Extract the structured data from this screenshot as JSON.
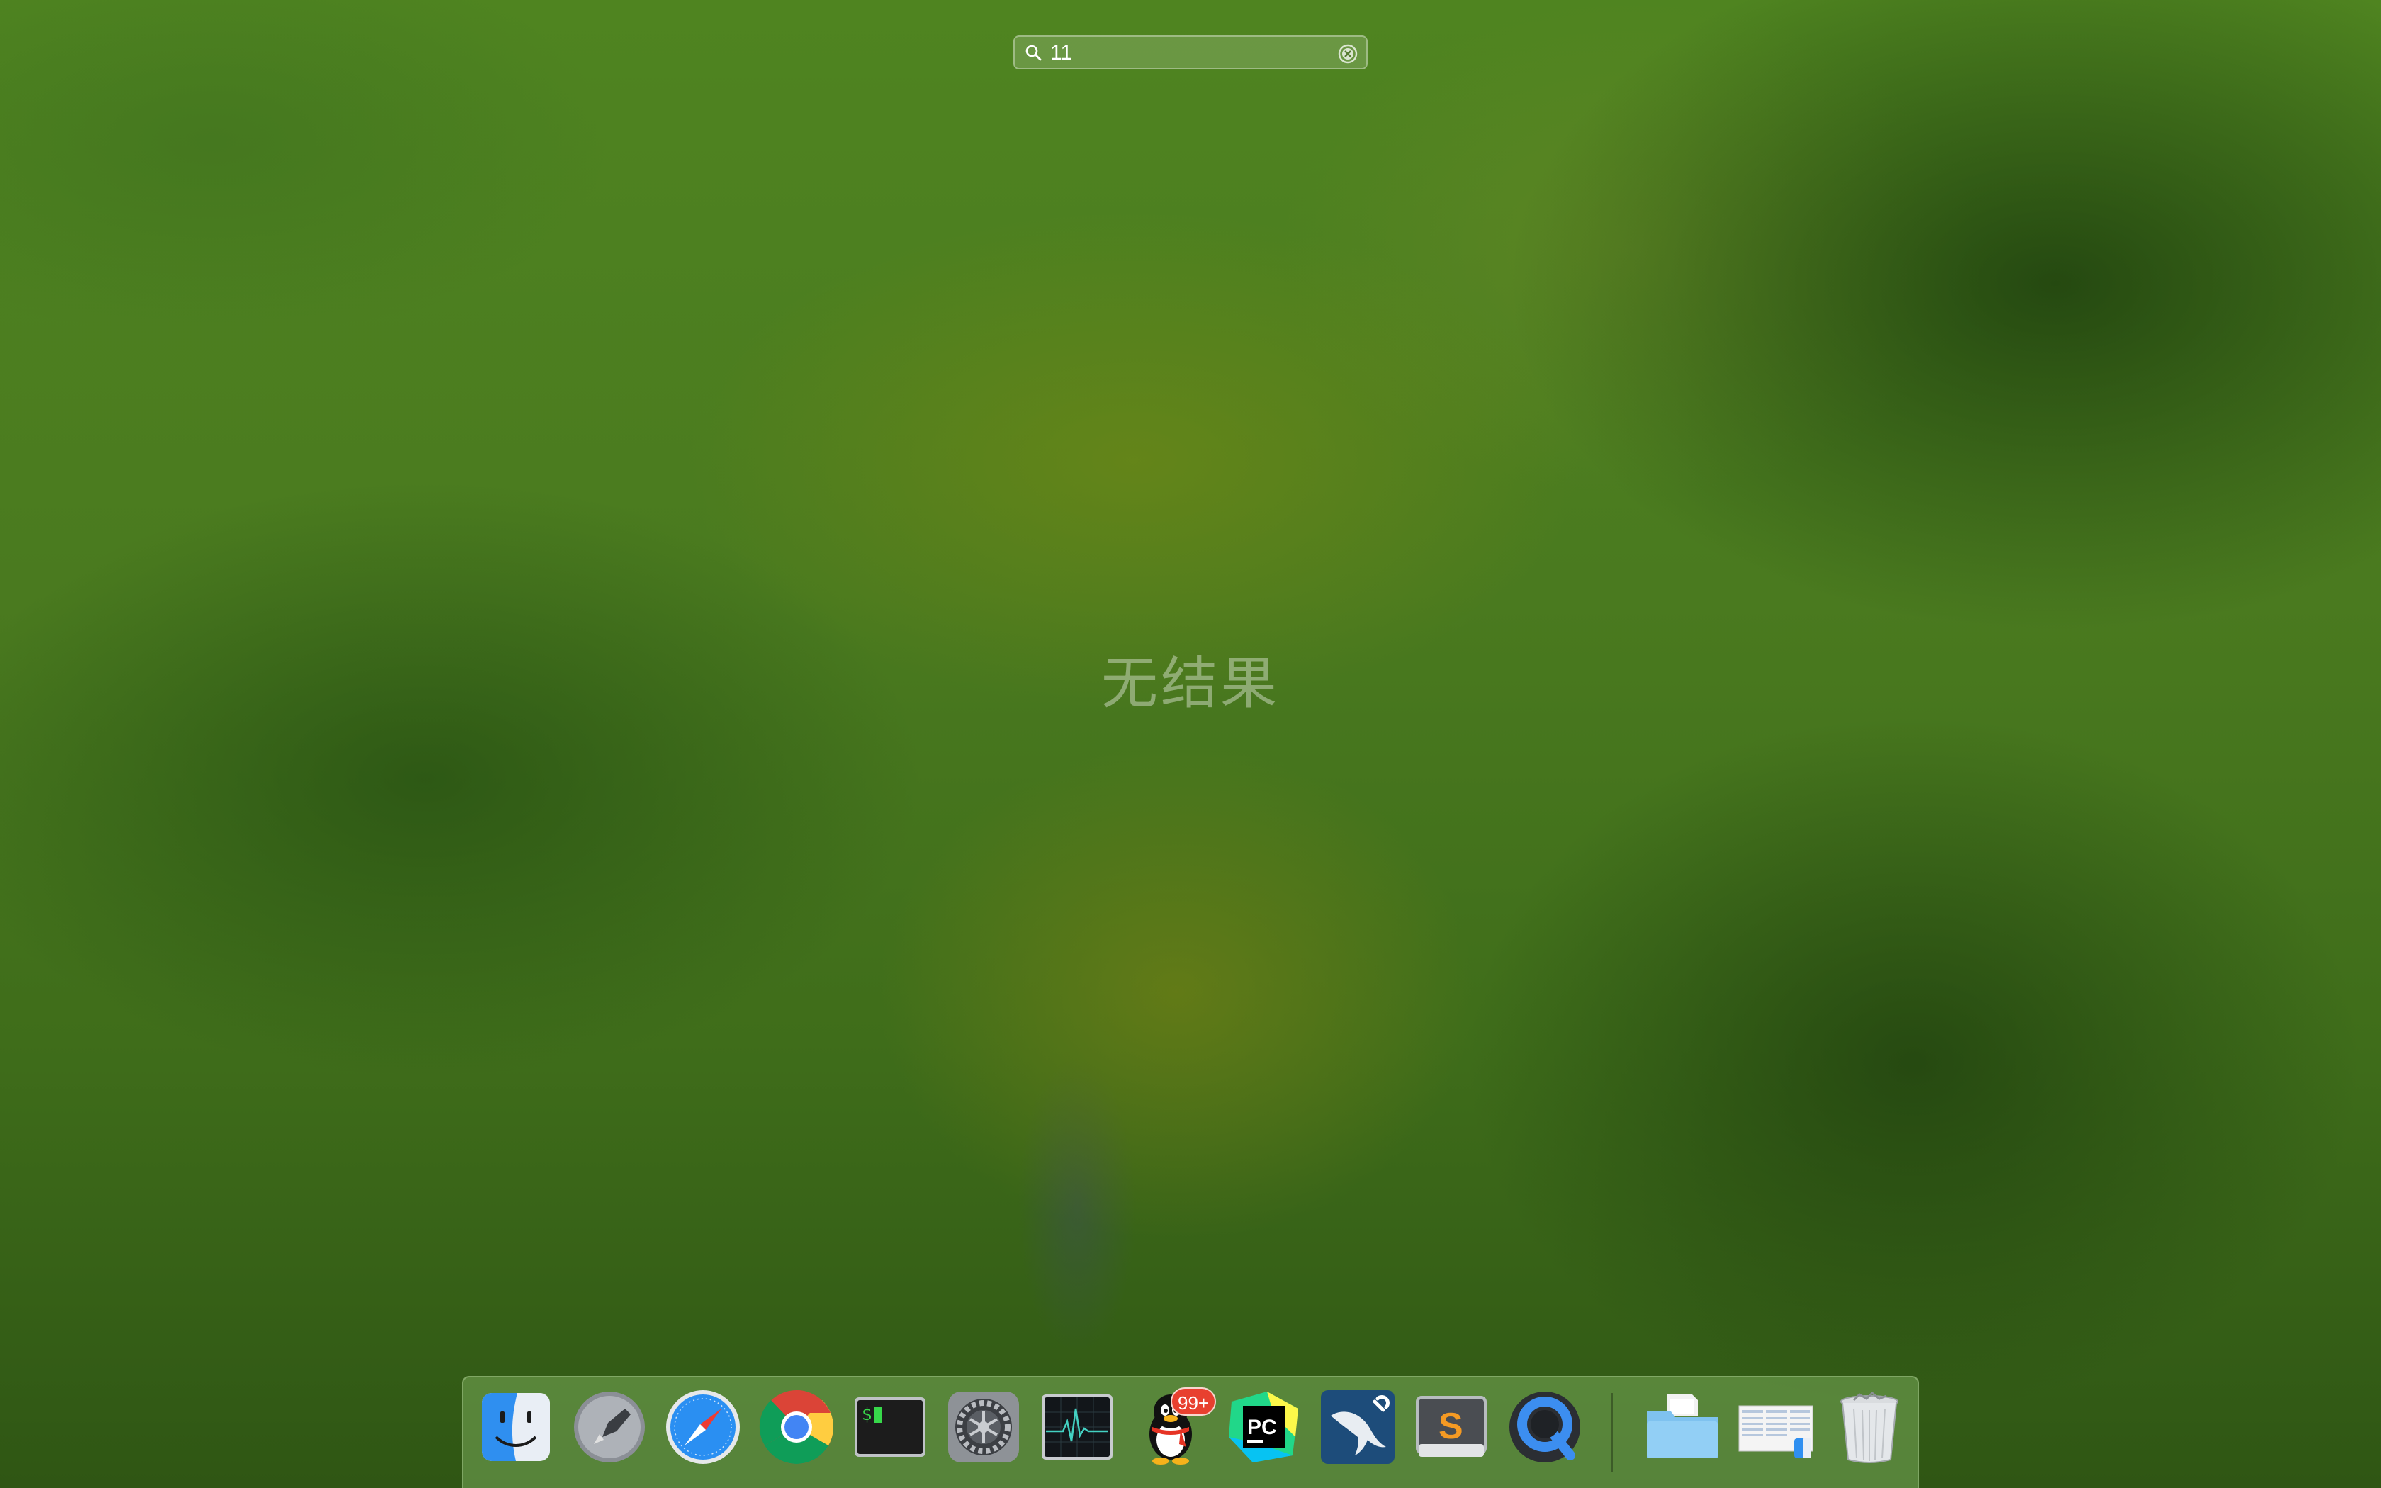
{
  "search": {
    "value": "11",
    "icon": "search-icon",
    "clear_icon": "clear-icon"
  },
  "main": {
    "no_results_text": "无结果"
  },
  "dock": {
    "items": [
      {
        "name": "finder",
        "icon": "finder-icon",
        "running": true
      },
      {
        "name": "launchpad",
        "icon": "launchpad-icon",
        "running": false
      },
      {
        "name": "safari",
        "icon": "safari-icon",
        "running": true
      },
      {
        "name": "chrome",
        "icon": "chrome-icon",
        "running": true
      },
      {
        "name": "terminal",
        "icon": "terminal-icon",
        "running": true
      },
      {
        "name": "system-preferences",
        "icon": "gear-icon",
        "running": false
      },
      {
        "name": "activity-monitor",
        "icon": "activity-monitor-icon",
        "running": false
      },
      {
        "name": "qq",
        "icon": "penguin-icon",
        "running": true,
        "badge": "99+"
      },
      {
        "name": "pycharm",
        "icon": "pycharm-icon",
        "running": true
      },
      {
        "name": "mysql-workbench",
        "icon": "dolphin-icon",
        "running": true
      },
      {
        "name": "sublime-text",
        "icon": "sublime-icon",
        "running": true
      },
      {
        "name": "quicktime",
        "icon": "quicktime-icon",
        "running": true
      },
      {
        "name": "downloads-folder",
        "icon": "folder-icon",
        "running": false
      },
      {
        "name": "documents-stack",
        "icon": "stack-icon",
        "running": false
      },
      {
        "name": "trash",
        "icon": "trash-icon",
        "running": false
      }
    ]
  },
  "colors": {
    "badge": "#e8402f",
    "no_results_text": "rgba(255,255,255,0.38)"
  }
}
